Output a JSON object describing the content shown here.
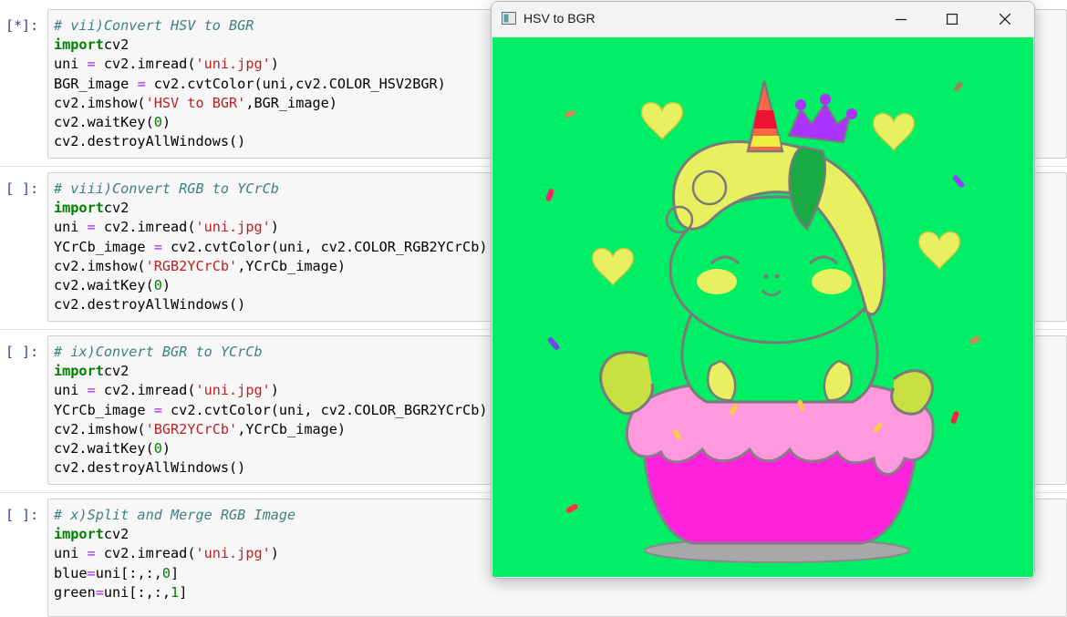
{
  "cells": [
    {
      "prompt": "[*]:",
      "lines": [
        [
          [
            "cm",
            "# vii)Convert HSV to BGR"
          ]
        ],
        [
          [
            "kw",
            "import"
          ],
          [
            "",
            "cv2"
          ]
        ],
        [
          [
            "",
            "uni "
          ],
          [
            "op",
            "="
          ],
          [
            "",
            " cv2.imread("
          ],
          [
            "st",
            "'uni.jpg'"
          ],
          [
            "",
            ")"
          ]
        ],
        [
          [
            "",
            "BGR_image "
          ],
          [
            "op",
            "="
          ],
          [
            "",
            " cv2.cvtColor(uni,cv2.COLOR_HSV2BGR)"
          ]
        ],
        [
          [
            "",
            "cv2.imshow("
          ],
          [
            "st",
            "'HSV to BGR'"
          ],
          [
            "",
            ",BGR_image)"
          ]
        ],
        [
          [
            "",
            "cv2.waitKey("
          ],
          [
            "nm",
            "0"
          ],
          [
            "",
            ")"
          ]
        ],
        [
          [
            "",
            "cv2.destroyAllWindows()"
          ]
        ]
      ]
    },
    {
      "prompt": "[ ]:",
      "lines": [
        [
          [
            "cm",
            "# viii)Convert RGB to YCrCb"
          ]
        ],
        [
          [
            "kw",
            "import"
          ],
          [
            "",
            "cv2"
          ]
        ],
        [
          [
            "",
            "uni "
          ],
          [
            "op",
            "="
          ],
          [
            "",
            " cv2.imread("
          ],
          [
            "st",
            "'uni.jpg'"
          ],
          [
            "",
            ")"
          ]
        ],
        [
          [
            "",
            "YCrCb_image "
          ],
          [
            "op",
            "="
          ],
          [
            "",
            " cv2.cvtColor(uni, cv2.COLOR_RGB2YCrCb)"
          ]
        ],
        [
          [
            "",
            "cv2.imshow("
          ],
          [
            "st",
            "'RGB2YCrCb'"
          ],
          [
            "",
            ",YCrCb_image)"
          ]
        ],
        [
          [
            "",
            "cv2.waitKey("
          ],
          [
            "nm",
            "0"
          ],
          [
            "",
            ")"
          ]
        ],
        [
          [
            "",
            "cv2.destroyAllWindows()"
          ]
        ]
      ]
    },
    {
      "prompt": "[ ]:",
      "lines": [
        [
          [
            "cm",
            "# ix)Convert BGR to YCrCb"
          ]
        ],
        [
          [
            "kw",
            "import"
          ],
          [
            "",
            "cv2"
          ]
        ],
        [
          [
            "",
            "uni "
          ],
          [
            "op",
            "="
          ],
          [
            "",
            " cv2.imread("
          ],
          [
            "st",
            "'uni.jpg'"
          ],
          [
            "",
            ")"
          ]
        ],
        [
          [
            "",
            "YCrCb_image "
          ],
          [
            "op",
            "="
          ],
          [
            "",
            " cv2.cvtColor(uni, cv2.COLOR_BGR2YCrCb)"
          ]
        ],
        [
          [
            "",
            "cv2.imshow("
          ],
          [
            "st",
            "'BGR2YCrCb'"
          ],
          [
            "",
            ",YCrCb_image)"
          ]
        ],
        [
          [
            "",
            "cv2.waitKey("
          ],
          [
            "nm",
            "0"
          ],
          [
            "",
            ")"
          ]
        ],
        [
          [
            "",
            "cv2.destroyAllWindows()"
          ]
        ]
      ]
    },
    {
      "prompt": "[ ]:",
      "lines": [
        [
          [
            "cm",
            "# x)Split and Merge RGB Image"
          ]
        ],
        [
          [
            "kw",
            "import"
          ],
          [
            "",
            "cv2"
          ]
        ],
        [
          [
            "",
            "uni "
          ],
          [
            "op",
            "="
          ],
          [
            "",
            " cv2.imread("
          ],
          [
            "st",
            "'uni.jpg'"
          ],
          [
            "",
            ")"
          ]
        ],
        [
          [
            "",
            "blue"
          ],
          [
            "op",
            "="
          ],
          [
            "",
            "uni[:,:,"
          ],
          [
            "nm",
            "0"
          ],
          [
            "",
            "]"
          ]
        ],
        [
          [
            "",
            "green"
          ],
          [
            "op",
            "="
          ],
          [
            "",
            "uni[:,:,"
          ],
          [
            "nm",
            "1"
          ],
          [
            "",
            "]"
          ]
        ]
      ]
    }
  ],
  "window": {
    "title": "HSV to BGR",
    "minimize_icon": "minimize-icon",
    "maximize_icon": "maximize-icon",
    "close_icon": "close-icon",
    "image_background": "#00ee66"
  }
}
